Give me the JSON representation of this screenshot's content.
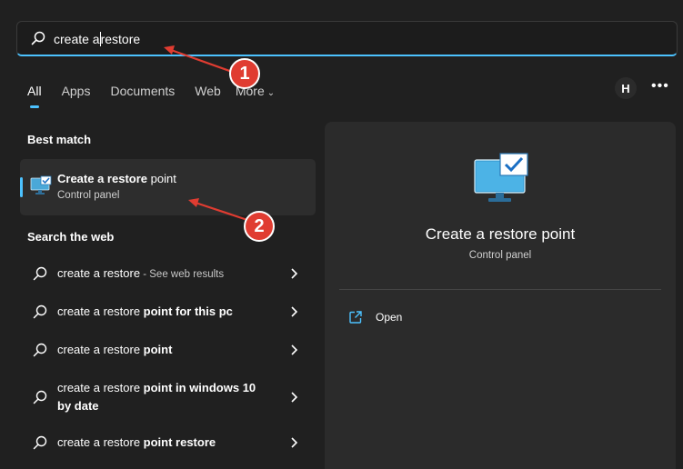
{
  "search": {
    "value_before_caret": "create a",
    "value_after_caret": "restore"
  },
  "tabs": [
    {
      "label": "All",
      "active": true
    },
    {
      "label": "Apps"
    },
    {
      "label": "Documents"
    },
    {
      "label": "Web"
    },
    {
      "label": "More"
    }
  ],
  "account": {
    "initial": "H"
  },
  "menu_glyph": "•••",
  "best_match": {
    "section_title": "Best match",
    "title_bold": "Create a restore",
    "title_rest": " point",
    "subtitle": "Control panel"
  },
  "search_web": {
    "section_title": "Search the web",
    "items": [
      {
        "text": "create a restore",
        "bold": "",
        "hint": " - See web results"
      },
      {
        "text": "create a restore ",
        "bold": "point for this pc",
        "hint": ""
      },
      {
        "text": "create a restore ",
        "bold": "point",
        "hint": ""
      },
      {
        "text": "create a restore ",
        "bold": "point in windows 10 by date",
        "hint": ""
      },
      {
        "text": "create a restore ",
        "bold": "point restore",
        "hint": ""
      }
    ]
  },
  "details": {
    "title": "Create a restore point",
    "subtitle": "Control panel",
    "open_label": "Open"
  },
  "annotations": [
    {
      "number": "1"
    },
    {
      "number": "2"
    }
  ],
  "colors": {
    "accent": "#4cc2ff",
    "background": "#202020",
    "panel": "#2b2b2b",
    "annotation_red": "#e03c31"
  }
}
